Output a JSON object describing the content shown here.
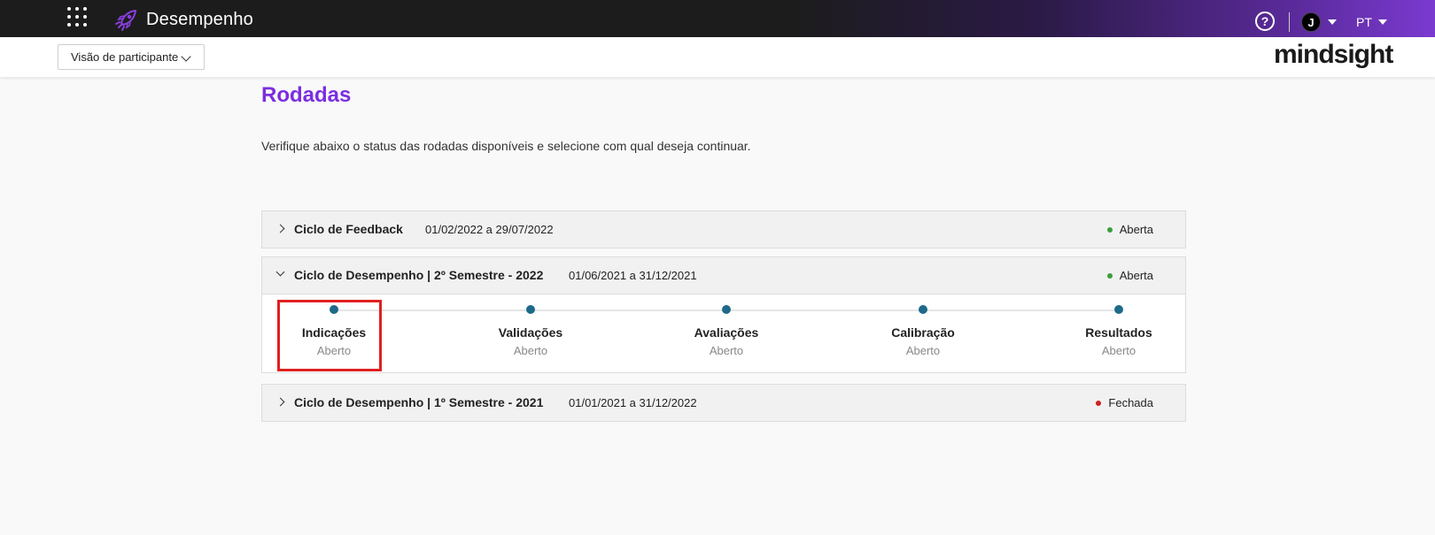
{
  "header": {
    "app_title": "Desempenho",
    "user_initial": "J",
    "language": "PT",
    "help_symbol": "?",
    "icons": [
      "apps-grid-icon",
      "rocket-icon",
      "help-icon",
      "caret-down-icon"
    ]
  },
  "subheader": {
    "view_select": "Visão de participante",
    "brand": "mindsight"
  },
  "main": {
    "title": "Rodadas",
    "description": "Verifique abaixo o status das rodadas disponíveis e selecione com qual deseja continuar.",
    "rounds": [
      {
        "name": "Ciclo de Feedback",
        "dates": "01/02/2022 a 29/07/2022",
        "status": "Aberta",
        "status_color": "#3aa03a",
        "expanded": false
      },
      {
        "name": "Ciclo de Desempenho | 2º Semestre - 2022",
        "dates": "01/06/2021 a 31/12/2021",
        "status": "Aberta",
        "status_color": "#3aa03a",
        "expanded": true,
        "steps": [
          {
            "label": "Indicações",
            "status": "Aberto"
          },
          {
            "label": "Validações",
            "status": "Aberto"
          },
          {
            "label": "Avaliações",
            "status": "Aberto"
          },
          {
            "label": "Calibração",
            "status": "Aberto"
          },
          {
            "label": "Resultados",
            "status": "Aberto"
          }
        ]
      },
      {
        "name": "Ciclo de Desempenho | 1º Semestre - 2021",
        "dates": "01/01/2021 a 31/12/2022",
        "status": "Fechada",
        "status_color": "#d02020",
        "expanded": false
      }
    ]
  },
  "colors": {
    "accent": "#7b2ee0",
    "step_dot": "#1d6a8a",
    "highlight": "#e02020"
  }
}
